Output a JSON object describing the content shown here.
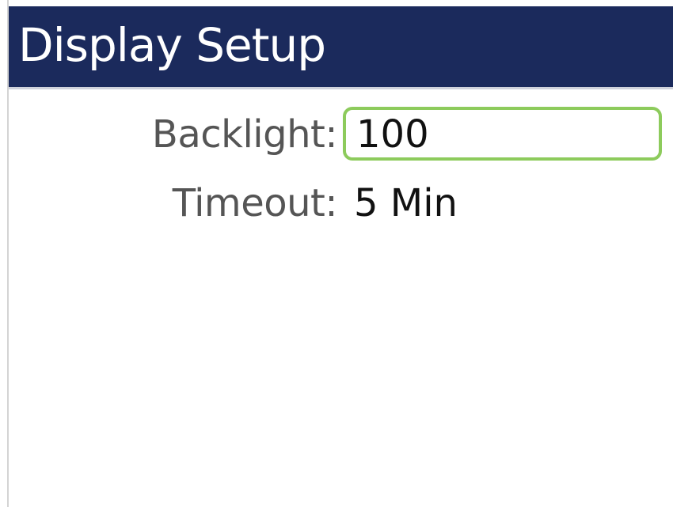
{
  "header": {
    "title": "Display Setup"
  },
  "settings": [
    {
      "label": "Backlight:",
      "value": "100",
      "selected": true
    },
    {
      "label": "Timeout:",
      "value": "5 Min",
      "selected": false
    }
  ],
  "colors": {
    "header_bg": "#1b2a5c",
    "header_text": "#ffffff",
    "selection_border": "#8dcb5c",
    "label_text": "#555555",
    "value_text": "#111111"
  }
}
